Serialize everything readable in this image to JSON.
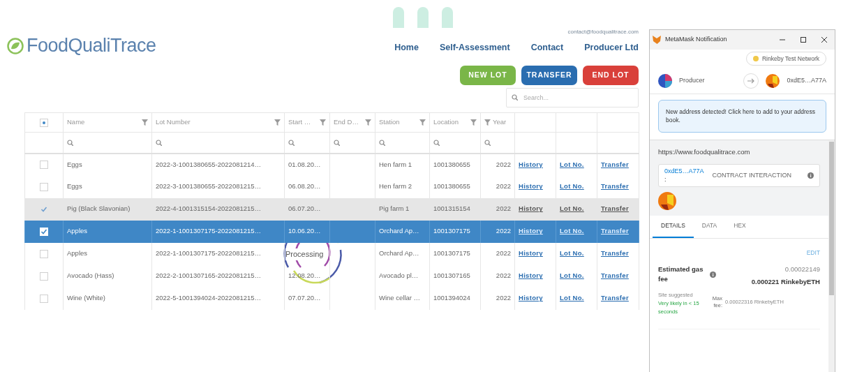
{
  "header": {
    "logo": "FoodQualiTrace",
    "email": "contact@foodqualitrace.com",
    "nav": [
      {
        "label": "Home"
      },
      {
        "label": "Self-Assessment"
      },
      {
        "label": "Contact"
      },
      {
        "label": "Producer Ltd"
      }
    ]
  },
  "actions": [
    {
      "label": "NEW LOT",
      "kind": "success"
    },
    {
      "label": "TRANSFER",
      "kind": "primary"
    },
    {
      "label": "END LOT",
      "kind": "danger"
    }
  ],
  "search": {
    "placeholder": "Search..."
  },
  "table": {
    "select_all_partial": true,
    "columns": [
      {
        "label": "Name",
        "filter": true,
        "kind": "text"
      },
      {
        "label": "Lot Number",
        "filter": true,
        "kind": "text"
      },
      {
        "label": "Start …",
        "filter": true,
        "kind": "text"
      },
      {
        "label": "End D…",
        "filter": true,
        "kind": "text"
      },
      {
        "label": "Station",
        "filter": true,
        "kind": "text"
      },
      {
        "label": "Location",
        "filter": true,
        "kind": "text"
      },
      {
        "label": "Year",
        "filter": true,
        "kind": "number"
      }
    ],
    "rows": [
      {
        "name": "Eggs",
        "lot": "2022-3-1001380655-2022081214…",
        "start": "01.08.20…",
        "station": "Hen farm 1",
        "location": "1001380655",
        "year": "2022",
        "links": [
          "History",
          "Lot No.",
          "Transfer"
        ],
        "checked": false,
        "selected": false,
        "hovered": false
      },
      {
        "name": "Eggs",
        "lot": "2022-3-1001380655-2022081215…",
        "start": "06.08.20…",
        "station": "Hen farm 2",
        "location": "1001380655",
        "year": "2022",
        "links": [
          "History",
          "Lot No.",
          "Transfer"
        ],
        "checked": false,
        "selected": false,
        "hovered": false
      },
      {
        "name": "Pig (Black Slavonian)",
        "lot": "2022-4-1001315154-2022081215…",
        "start": "06.07.20…",
        "station": "Pig farm 1",
        "location": "1001315154",
        "year": "2022",
        "links": [
          "History",
          "Lot No.",
          "Transfer"
        ],
        "checked": true,
        "selected": false,
        "hovered": true
      },
      {
        "name": "Apples",
        "lot": "2022-1-1001307175-2022081215…",
        "start": "10.06.20…",
        "station": "Orchard Ap…",
        "location": "1001307175",
        "year": "2022",
        "links": [
          "History",
          "Lot No.",
          "Transfer"
        ],
        "checked": true,
        "selected": true,
        "hovered": false
      },
      {
        "name": "Apples",
        "lot": "2022-1-1001307175-2022081215…",
        "station": "Orchard Ap…",
        "location": "1001307175",
        "year": "2022",
        "links": [
          "History",
          "Lot No.",
          "Transfer"
        ],
        "checked": false,
        "selected": false,
        "hovered": false
      },
      {
        "name": "Avocado (Hass)",
        "lot": "2022-2-1001307165-2022081215…",
        "start": "12.08.20…",
        "station": "Avocado pl…",
        "location": "1001307165",
        "year": "2022",
        "links": [
          "History",
          "Lot No.",
          "Transfer"
        ],
        "checked": false,
        "selected": false,
        "hovered": false
      },
      {
        "name": "Wine (White)",
        "lot": "2022-5-1001394024-2022081215…",
        "start": "07.07.20…",
        "station": "Wine cellar …",
        "location": "1001394024",
        "year": "2022",
        "links": [
          "History",
          "Lot No.",
          "Transfer"
        ],
        "checked": false,
        "selected": false,
        "hovered": false
      }
    ]
  },
  "loading": {
    "label": "Processing"
  },
  "metamask": {
    "title": "MetaMask Notification",
    "network": "Rinkeby Test Network",
    "from": "Producer",
    "to": "0xdE5…A77A",
    "alert": "New address detected! Click here to add to your address book.",
    "origin": "https://www.foodqualitrace.com",
    "contract": {
      "address": "0xdE5…A77A",
      "suffix": ":",
      "label": "CONTRACT INTERACTION"
    },
    "tabs": [
      {
        "label": "DETAILS",
        "selected": true
      },
      {
        "label": "DATA",
        "selected": false
      },
      {
        "label": "HEX",
        "selected": false
      }
    ],
    "edit": "EDIT",
    "gas": {
      "label": "Estimated gas fee",
      "fiat": "0.00022149",
      "amount": "0.000221 RinkebyETH",
      "note": "Site suggested",
      "likely": "Very likely in < 15 seconds",
      "max_label": "Max fee:",
      "max": "0.00022316 RinkebyETH"
    }
  }
}
